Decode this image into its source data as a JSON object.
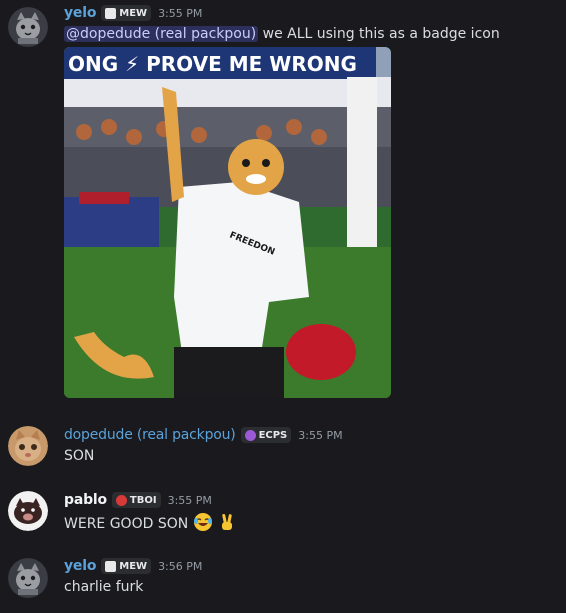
{
  "messages": [
    {
      "username": "yelo",
      "username_color": "#5aa2d9",
      "tag": "MEW",
      "time": "3:55 PM",
      "mention": "@dopedude (real packpou)",
      "text": " we ALL using this as a badge icon",
      "image": {
        "banner_text": "ONG ⚡ PROVE ME WRONG",
        "shirt_text": "FREEDON"
      }
    },
    {
      "username": "dopedude (real packpou)",
      "username_color": "#5aa2d9",
      "tag": "ECPS",
      "time": "3:55 PM",
      "text": "SON"
    },
    {
      "username": "pablo",
      "username_color": "#f2f3f5",
      "tag": "TBOI",
      "time": "3:55 PM",
      "text": "WERE GOOD SON"
    },
    {
      "username": "yelo",
      "username_color": "#5aa2d9",
      "tag": "MEW",
      "time": "3:56 PM",
      "text": "charlie furk"
    }
  ],
  "icons": [
    "cat-avatar-icon",
    "mew-tag-icon",
    "ecps-tag-icon",
    "tboi-tag-icon",
    "laughing-emoji-icon",
    "victory-hand-emoji-icon"
  ]
}
